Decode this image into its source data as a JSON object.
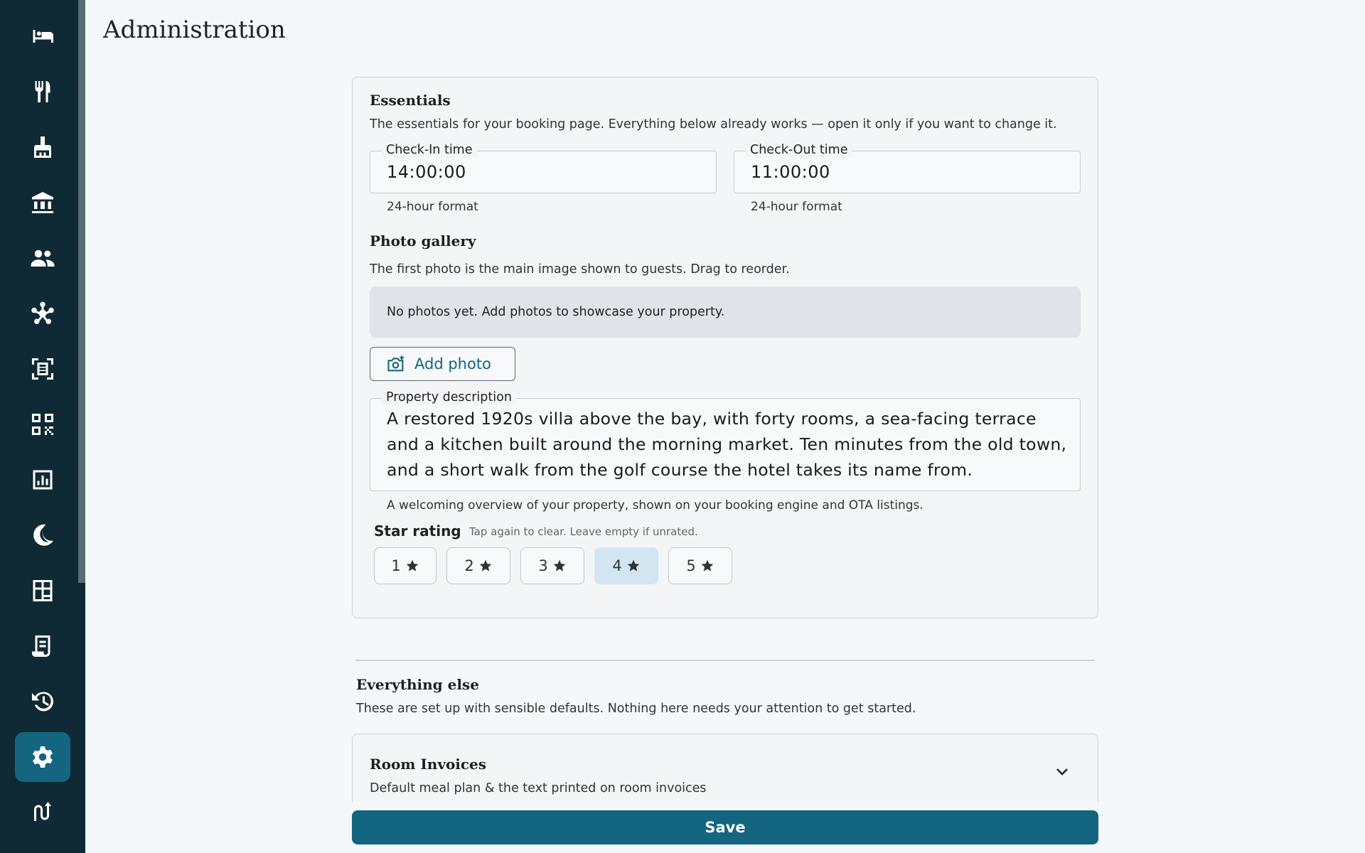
{
  "page": {
    "title": "Administration"
  },
  "sidebar": {
    "items": [
      {
        "icon": "bed-icon",
        "active": false
      },
      {
        "icon": "restaurant-icon",
        "active": false
      },
      {
        "icon": "cleaning-icon",
        "active": false
      },
      {
        "icon": "bank-icon",
        "active": false
      },
      {
        "icon": "people-icon",
        "active": false
      },
      {
        "icon": "network-icon",
        "active": false
      },
      {
        "icon": "document-scan-icon",
        "active": false
      },
      {
        "icon": "qr-code-icon",
        "active": false
      },
      {
        "icon": "report-icon",
        "active": false
      },
      {
        "icon": "night-audit-icon",
        "active": false
      },
      {
        "icon": "building-icon",
        "active": false
      },
      {
        "icon": "receipt-icon",
        "active": false
      },
      {
        "icon": "history-icon",
        "active": false
      },
      {
        "icon": "gear-icon",
        "active": true
      },
      {
        "icon": "channel-icon",
        "active": false
      }
    ]
  },
  "essentials": {
    "title": "Essentials",
    "description": "The essentials for your booking page. Everything below already works — open it only if you want to change it.",
    "checkin": {
      "label": "Check-In time",
      "value": "14:00:00",
      "helper": "24-hour format"
    },
    "checkout": {
      "label": "Check-Out time",
      "value": "11:00:00",
      "helper": "24-hour format"
    },
    "gallery": {
      "title": "Photo gallery",
      "description": "The first photo is the main image shown to guests. Drag to reorder.",
      "empty_text": "No photos yet. Add photos to showcase your property.",
      "add_label": "Add photo"
    },
    "property_description": {
      "label": "Property description",
      "lines": [
        "A restored 1920s villa above the bay, with forty rooms, a sea-facing terrace",
        "and a kitchen built around the morning market. Ten minutes from the old town,",
        "and a short walk from the golf course the hotel takes its name from."
      ],
      "helper": "A welcoming overview of your property, shown on your booking engine and OTA listings."
    },
    "star_rating": {
      "label": "Star rating",
      "hint": "Tap again to clear. Leave empty if unrated.",
      "options": [
        "1",
        "2",
        "3",
        "4",
        "5"
      ],
      "selected": 4
    }
  },
  "everything_else": {
    "title": "Everything else",
    "description": "These are set up with sensible defaults. Nothing here needs your attention to get started.",
    "room_invoices": {
      "title": "Room Invoices",
      "description": "Default meal plan & the text printed on room invoices"
    }
  },
  "save_label": "Save"
}
